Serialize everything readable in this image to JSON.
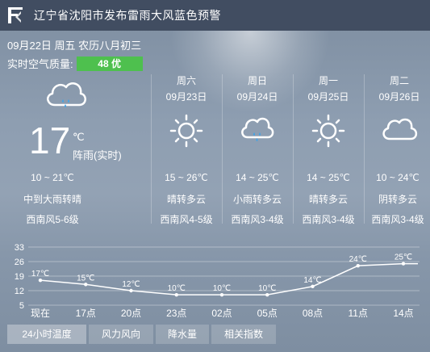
{
  "header": {
    "title": "辽宁省沈阳市发布雷雨大风蓝色预警"
  },
  "today": {
    "date_line": "09月22日 周五 农历八月初三",
    "aqi_label": "实时空气质量:",
    "aqi_value": "48 优",
    "temp": "17",
    "unit": "℃",
    "desc": "阵雨(实时)",
    "range": "10 ~ 21℃",
    "weather": "中到大雨转晴",
    "wind": "西南风5-6级",
    "icon": "cloud-rain-icon"
  },
  "forecast": [
    {
      "day": "周六",
      "date": "09月23日",
      "icon": "sun-icon",
      "range": "15 ~ 26℃",
      "weather": "晴转多云",
      "wind": "西南风4-5级"
    },
    {
      "day": "周日",
      "date": "09月24日",
      "icon": "cloud-rain-icon",
      "range": "14 ~ 25℃",
      "weather": "小雨转多云",
      "wind": "西南风3-4级"
    },
    {
      "day": "周一",
      "date": "09月25日",
      "icon": "sun-icon",
      "range": "14 ~ 25℃",
      "weather": "晴转多云",
      "wind": "西南风3-4级"
    },
    {
      "day": "周二",
      "date": "09月26日",
      "icon": "cloud-icon",
      "range": "10 ~ 24℃",
      "weather": "阴转多云",
      "wind": "西南风3-4级"
    }
  ],
  "chart_data": {
    "type": "line",
    "title": "",
    "xlabel": "",
    "ylabel": "",
    "categories": [
      "现在",
      "17点",
      "20点",
      "23点",
      "02点",
      "05点",
      "08点",
      "11点",
      "14点"
    ],
    "values": [
      17,
      15,
      12,
      10,
      10,
      10,
      14,
      24,
      25
    ],
    "value_labels": [
      "17℃",
      "15℃",
      "12℃",
      "10℃",
      "10℃",
      "10℃",
      "14℃",
      "24℃",
      "25℃"
    ],
    "yticks": [
      33,
      26,
      19,
      12,
      5
    ],
    "ylim": [
      5,
      33
    ],
    "grid": true
  },
  "tabs": [
    {
      "label": "24小时温度",
      "active": true
    },
    {
      "label": "风力风向",
      "active": false
    },
    {
      "label": "降水量",
      "active": false
    },
    {
      "label": "相关指数",
      "active": false
    }
  ]
}
